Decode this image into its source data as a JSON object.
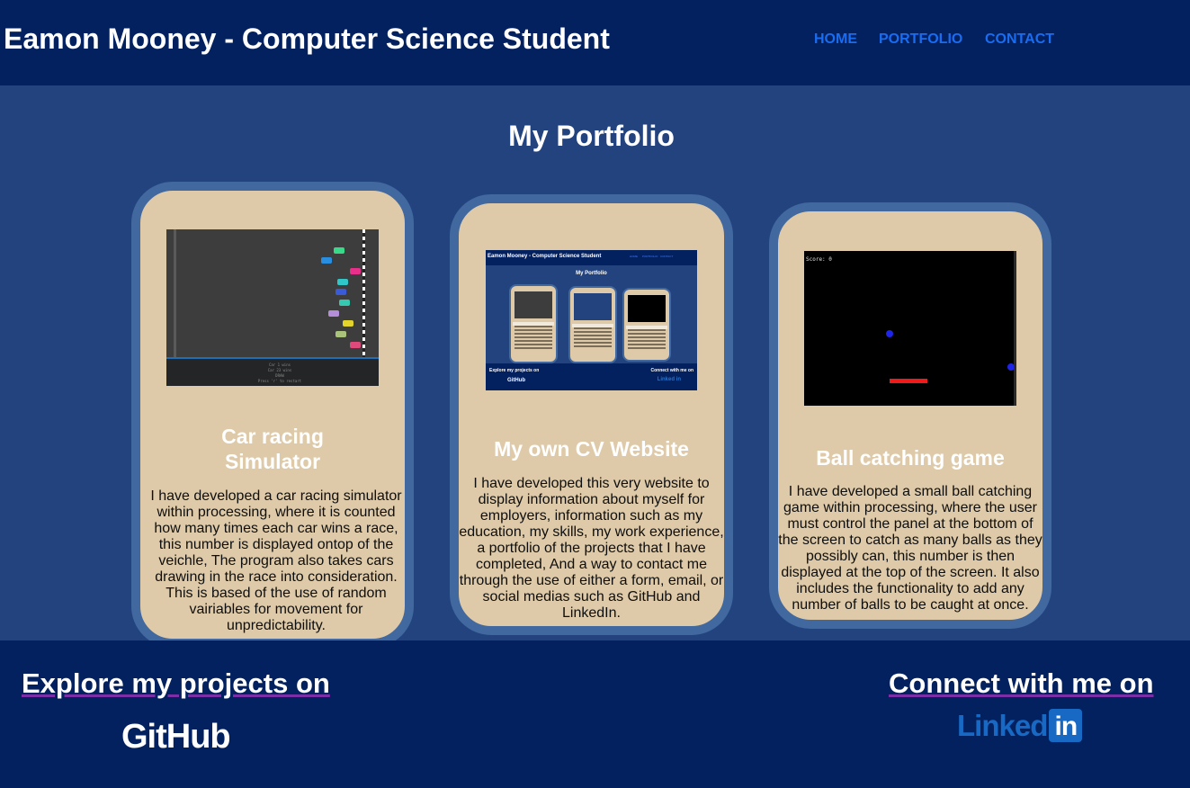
{
  "header": {
    "title": "Eamon Mooney - Computer Science Student",
    "nav": [
      "HOME",
      "PORTFOLIO",
      "CONTACT"
    ]
  },
  "main": {
    "heading": "My Portfolio",
    "projects": [
      {
        "title_line1": "Car racing",
        "title_line2": "Simulator",
        "description": "I have developed a car racing simulator within processing, where it is counted how many times each car wins a race, this number is displayed ontop of the veichle, The program also takes cars drawing in the race into consideration. This is based of the use of random vairiables for movement for unpredictability.",
        "thumbnail": {
          "lines": [
            "Car 1 wins",
            "Car 23 wins",
            "DRAW",
            "Press 'r' to restart"
          ]
        }
      },
      {
        "title": "My own CV Website",
        "description": "I have developed this very website to display information about myself for employers, information such as my education, my skills, my work experience, a portfolio of the projects that I have completed, And a way to contact me through the use of either a form, email, or social medias such as GitHub and LinkedIn.",
        "thumbnail": {
          "title": "Eamon Mooney - Computer Science Student",
          "nav": [
            "HOME",
            "PORTFOLIO",
            "CONTACT"
          ],
          "heading": "My Portfolio",
          "footer_left": "Explore my projects on",
          "footer_right": "Connect with me on",
          "github": "GitHub",
          "linkedin": "Linked in"
        }
      },
      {
        "title": "Ball catching game",
        "description": "I have developed a small ball catching game within processing, where the user must control the panel at the bottom of the screen to catch as many balls as they possibly can, this number is then displayed at the top of the screen. It also includes the functionality to add any number of balls to be caught at once.",
        "thumbnail": {
          "score": "Score: 0"
        }
      }
    ]
  },
  "footer": {
    "explore_text": "Explore my projects on",
    "github_logo": "GitHub",
    "connect_text": "Connect with me on",
    "linkedin_logo_text": "Linked",
    "linkedin_logo_box": "in"
  },
  "colors": {
    "header_bg": "#03205f",
    "page_bg": "#23437f",
    "card_bg": "#decaa8",
    "card_border": "#41689f",
    "nav_link": "#1a6cf0",
    "linkedin_blue": "#1769c4"
  }
}
